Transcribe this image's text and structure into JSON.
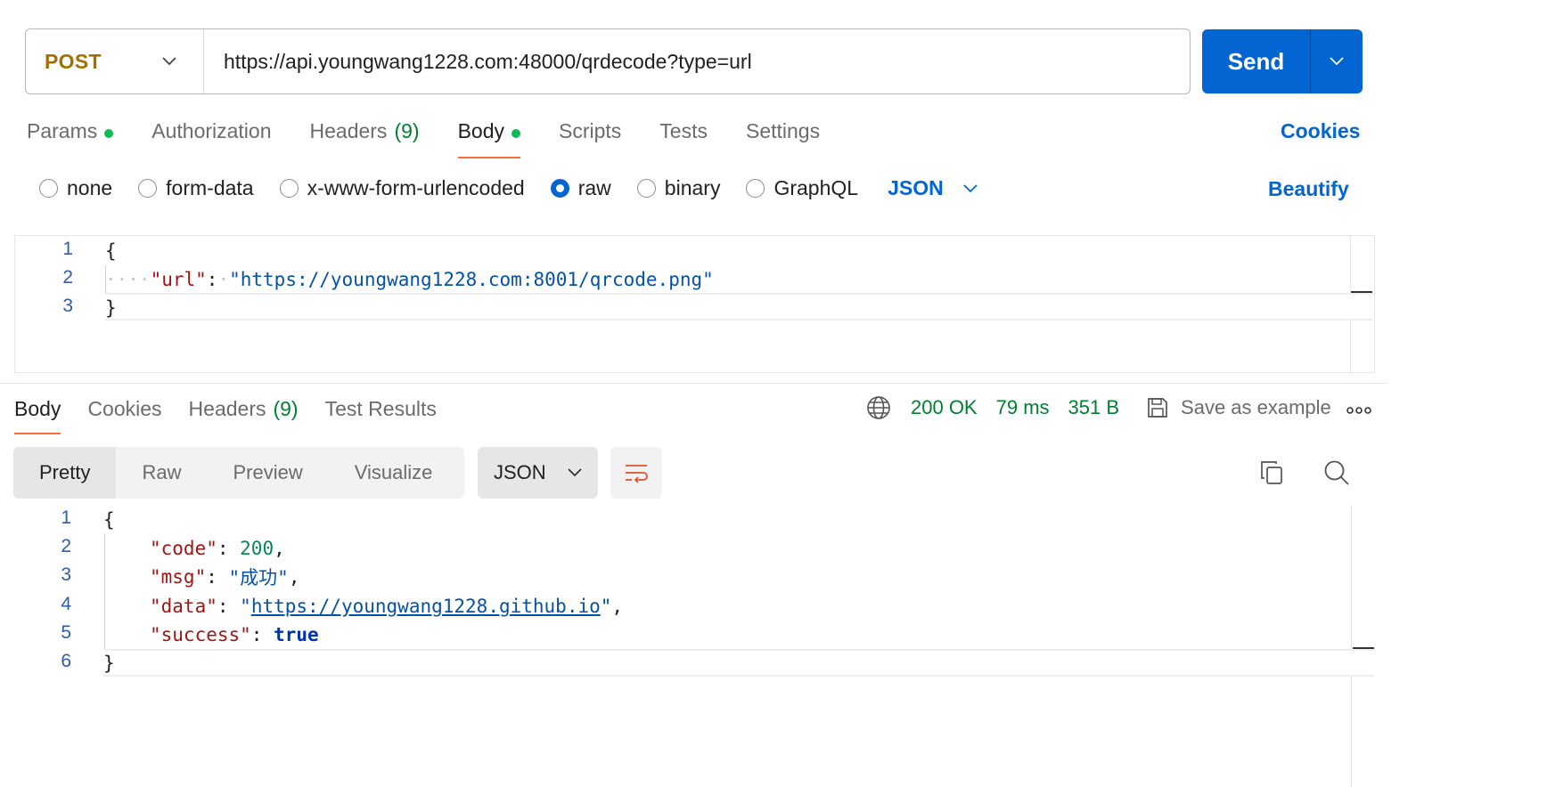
{
  "request": {
    "method": "POST",
    "url": "https://api.youngwang1228.com:48000/qrdecode?type=url",
    "send_label": "Send",
    "tabs": [
      {
        "label": "Params",
        "dot": true
      },
      {
        "label": "Authorization"
      },
      {
        "label": "Headers",
        "count": "(9)"
      },
      {
        "label": "Body",
        "dot": true,
        "active": true
      },
      {
        "label": "Scripts"
      },
      {
        "label": "Tests"
      },
      {
        "label": "Settings"
      }
    ],
    "cookies_label": "Cookies",
    "body_types": [
      "none",
      "form-data",
      "x-www-form-urlencoded",
      "raw",
      "binary",
      "GraphQL"
    ],
    "selected_body_type": "raw",
    "raw_format": "JSON",
    "beautify_label": "Beautify",
    "body_lines": [
      "1",
      "2",
      "3"
    ],
    "body_code": {
      "open": "{",
      "key": "\"url\"",
      "colon": ":",
      "value": "\"https://youngwang1228.com:8001/qrcode.png\"",
      "close": "}"
    }
  },
  "response": {
    "tabs": [
      {
        "label": "Body",
        "active": true
      },
      {
        "label": "Cookies"
      },
      {
        "label": "Headers",
        "count": "(9)"
      },
      {
        "label": "Test Results"
      }
    ],
    "status": "200 OK",
    "time": "79 ms",
    "size": "351 B",
    "save_label": "Save as example",
    "view_tabs": [
      "Pretty",
      "Raw",
      "Preview",
      "Visualize"
    ],
    "format": "JSON",
    "line_numbers": [
      "1",
      "2",
      "3",
      "4",
      "5",
      "6"
    ],
    "json": {
      "code_key": "\"code\"",
      "code_val": "200",
      "msg_key": "\"msg\"",
      "msg_val": "\"成功\"",
      "data_key": "\"data\"",
      "data_val": "https://youngwang1228.github.io",
      "success_key": "\"success\"",
      "success_val": "true"
    }
  },
  "icons": {
    "globe": "globe-icon",
    "save": "save-icon",
    "more": "more-icon",
    "wrap": "wrap-lines-icon",
    "copy": "copy-icon",
    "search": "search-icon",
    "chevron": "chevron-down-icon"
  },
  "colors": {
    "accent": "#0265d2",
    "tab_underline": "#ff6c37",
    "success": "#007f31",
    "method": "#a37000"
  }
}
